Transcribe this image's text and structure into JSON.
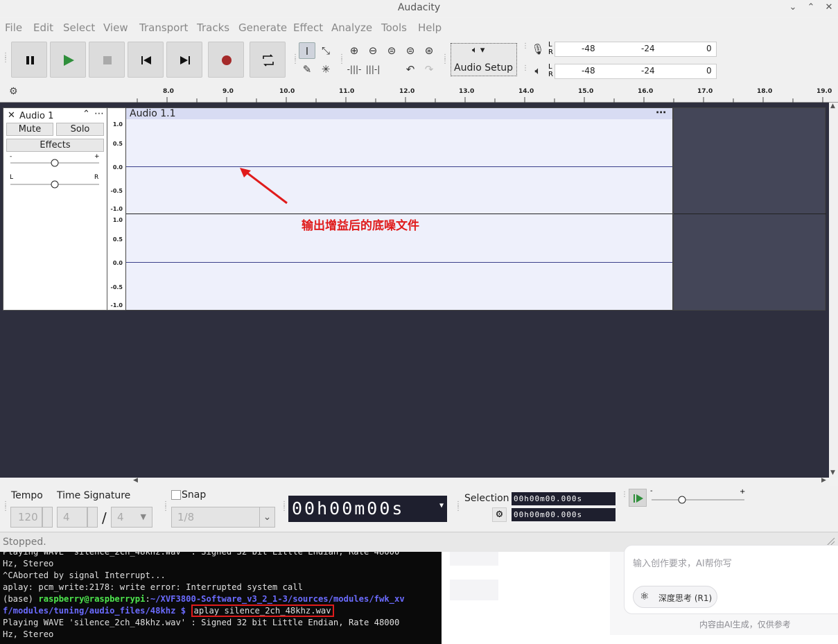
{
  "window": {
    "title": "Audacity",
    "minimize_icon": "chevron-down",
    "maximize_icon": "chevron-up",
    "close_icon": "close"
  },
  "menu": [
    "File",
    "Edit",
    "Select",
    "View",
    "Transport",
    "Tracks",
    "Generate",
    "Effect",
    "Analyze",
    "Tools",
    "Help"
  ],
  "transport": {
    "buttons": [
      "pause",
      "play",
      "stop",
      "skip-to-start",
      "skip-to-end",
      "record",
      "loop"
    ]
  },
  "tools": {
    "edit_tools": [
      "selection-tool",
      "envelope-tool",
      "draw-tool",
      "multi-tool"
    ],
    "zoom_tools": [
      "zoom-in",
      "zoom-out",
      "fit-selection",
      "fit-project",
      "zoom-toggle"
    ],
    "edit_actions": [
      "trim-audio",
      "silence-audio",
      "undo",
      "redo"
    ]
  },
  "audio_setup": {
    "label": "Audio Setup",
    "icon": "speaker"
  },
  "meters": {
    "record": {
      "channels": [
        "L",
        "R"
      ],
      "ticks": [
        "-48",
        "-24",
        "0"
      ]
    },
    "playback": {
      "channels": [
        "L",
        "R"
      ],
      "ticks": [
        "-48",
        "-24",
        "0"
      ]
    }
  },
  "ruler": {
    "ticks": [
      "8.0",
      "9.0",
      "10.0",
      "11.0",
      "12.0",
      "13.0",
      "14.0",
      "15.0",
      "16.0",
      "17.0",
      "18.0",
      "19.0"
    ]
  },
  "track": {
    "name": "Audio 1",
    "mute_label": "Mute",
    "solo_label": "Solo",
    "effects_label": "Effects",
    "gain_min": "-",
    "gain_max": "+",
    "pan_left": "L",
    "pan_right": "R",
    "clip_name": "Audio 1.1",
    "scale_ticks": [
      "1.0",
      "0.5",
      "0.0",
      "-0.5",
      "-1.0"
    ]
  },
  "annotation": {
    "text": "输出增益后的底噪文件",
    "color": "#e01b1b"
  },
  "bottom": {
    "tempo_label": "Tempo",
    "tempo_value": "120",
    "time_signature_label": "Time Signature",
    "ts_upper": "4",
    "ts_divider": "/",
    "ts_lower": "4",
    "snap_label": "Snap",
    "snap_value": "1/8",
    "time_display": "00h00m00s",
    "selection_label": "Selection",
    "selection_start": "00h00m00.000s",
    "selection_end": "00h00m00.000s",
    "speed_min": "-",
    "speed_max": "+"
  },
  "status": {
    "text": "Stopped."
  },
  "terminal": {
    "lines": [
      {
        "text": "Playing WAVE 'silence_2ch_48khz.wav' : Signed 32 bit Little Endian, Rate 48000"
      },
      {
        "text": "Hz, Stereo"
      },
      {
        "text": "^CAborted by signal Interrupt..."
      },
      {
        "text": "aplay: pcm_write:2178: write error: Interrupted system call"
      }
    ],
    "prompt_env": "(base) ",
    "prompt_user": "raspberry@raspberrypi",
    "prompt_colon": ":",
    "prompt_path_1": "~/XVF3800-Software_v3_2_1-3/sources/modules/fwk_xv",
    "prompt_path_2": "f/modules/tuning/audio_files/48khz $ ",
    "command": "aplay silence_2ch_48khz.wav",
    "output_1": "Playing WAVE 'silence_2ch_48khz.wav' : Signed 32 bit Little Endian, Rate 48000",
    "output_2": "Hz, Stereo"
  },
  "side_panel": {
    "placeholder": "输入创作要求，AI帮你写",
    "deep_think_label": "深度思考 (R1)",
    "disclaimer": "内容由AI生成，仅供参考"
  }
}
